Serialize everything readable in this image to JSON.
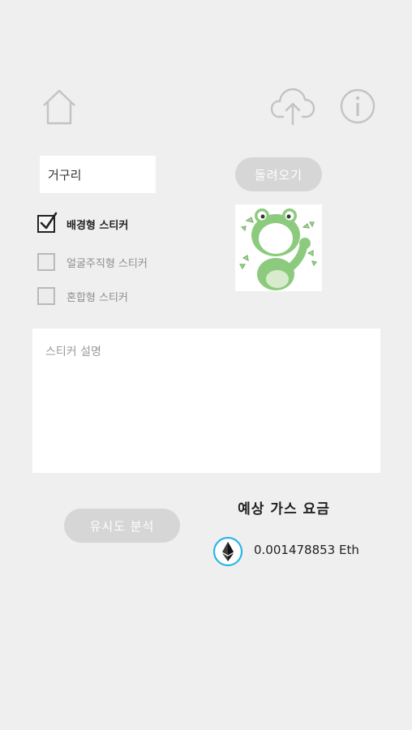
{
  "header": {
    "home_icon": "home-icon",
    "upload_icon": "cloud-upload-icon",
    "info_icon": "info-icon"
  },
  "form": {
    "name_value": "거구리",
    "reload_label": "돌려오기",
    "sticker_image": "frog-sticker-image",
    "options": [
      {
        "label": "배경형 스티커",
        "checked": true
      },
      {
        "label": "얼굴주직형 스티커",
        "checked": false
      },
      {
        "label": "혼합형 스티커",
        "checked": false
      }
    ],
    "description_placeholder": "스티커 설명"
  },
  "actions": {
    "similarity_label": "유시도 분석"
  },
  "gas": {
    "title": "예상 가스 요금",
    "value": "0.001478853 Eth",
    "icon": "ethereum-icon"
  },
  "colors": {
    "background": "#efefef",
    "pill_button": "#d6d6d6",
    "eth_ring": "#29b6e8",
    "frog_green": "#86c97a"
  }
}
